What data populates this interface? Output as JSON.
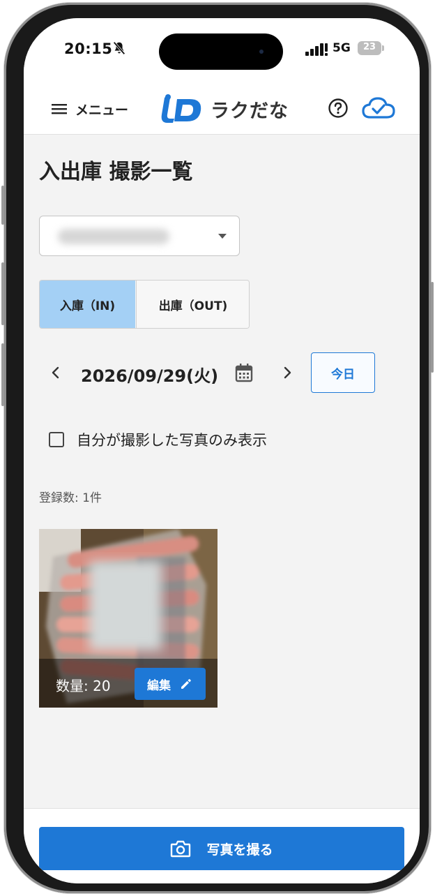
{
  "status_bar": {
    "time": "20:15",
    "network": "5G",
    "battery": "23",
    "icons": [
      "bell-slash-icon",
      "signal-icon",
      "battery-icon"
    ]
  },
  "app_bar": {
    "menu_label": "メニュー",
    "logo_text": "ラクだな",
    "icons": [
      "hamburger-menu-icon",
      "help-icon",
      "cloud-check-icon"
    ],
    "accent_color": "#1e78d6"
  },
  "page": {
    "title": "入出庫 撮影一覧"
  },
  "filter": {
    "warehouse_dropdown_value": ""
  },
  "direction_toggle": {
    "in_label": "入庫（IN)",
    "out_label": "出庫（OUT)",
    "selected": "in",
    "selected_color": "#a4d0f5"
  },
  "date_nav": {
    "date": "2026/09/29(火)",
    "today_label": "今日",
    "icons": [
      "chevron-left-icon",
      "calendar-icon",
      "chevron-right-icon"
    ]
  },
  "own_photos_filter": {
    "label": "自分が撮影した写真のみ表示",
    "checked": false
  },
  "registration": {
    "count_text": "登録数: 1件"
  },
  "photos": [
    {
      "quantity_text": "数量: 20",
      "edit_label": "編集",
      "icons": [
        "pencil-icon"
      ]
    }
  ],
  "bottom_action": {
    "take_photo_label": "写真を撮る",
    "icons": [
      "camera-icon"
    ]
  }
}
